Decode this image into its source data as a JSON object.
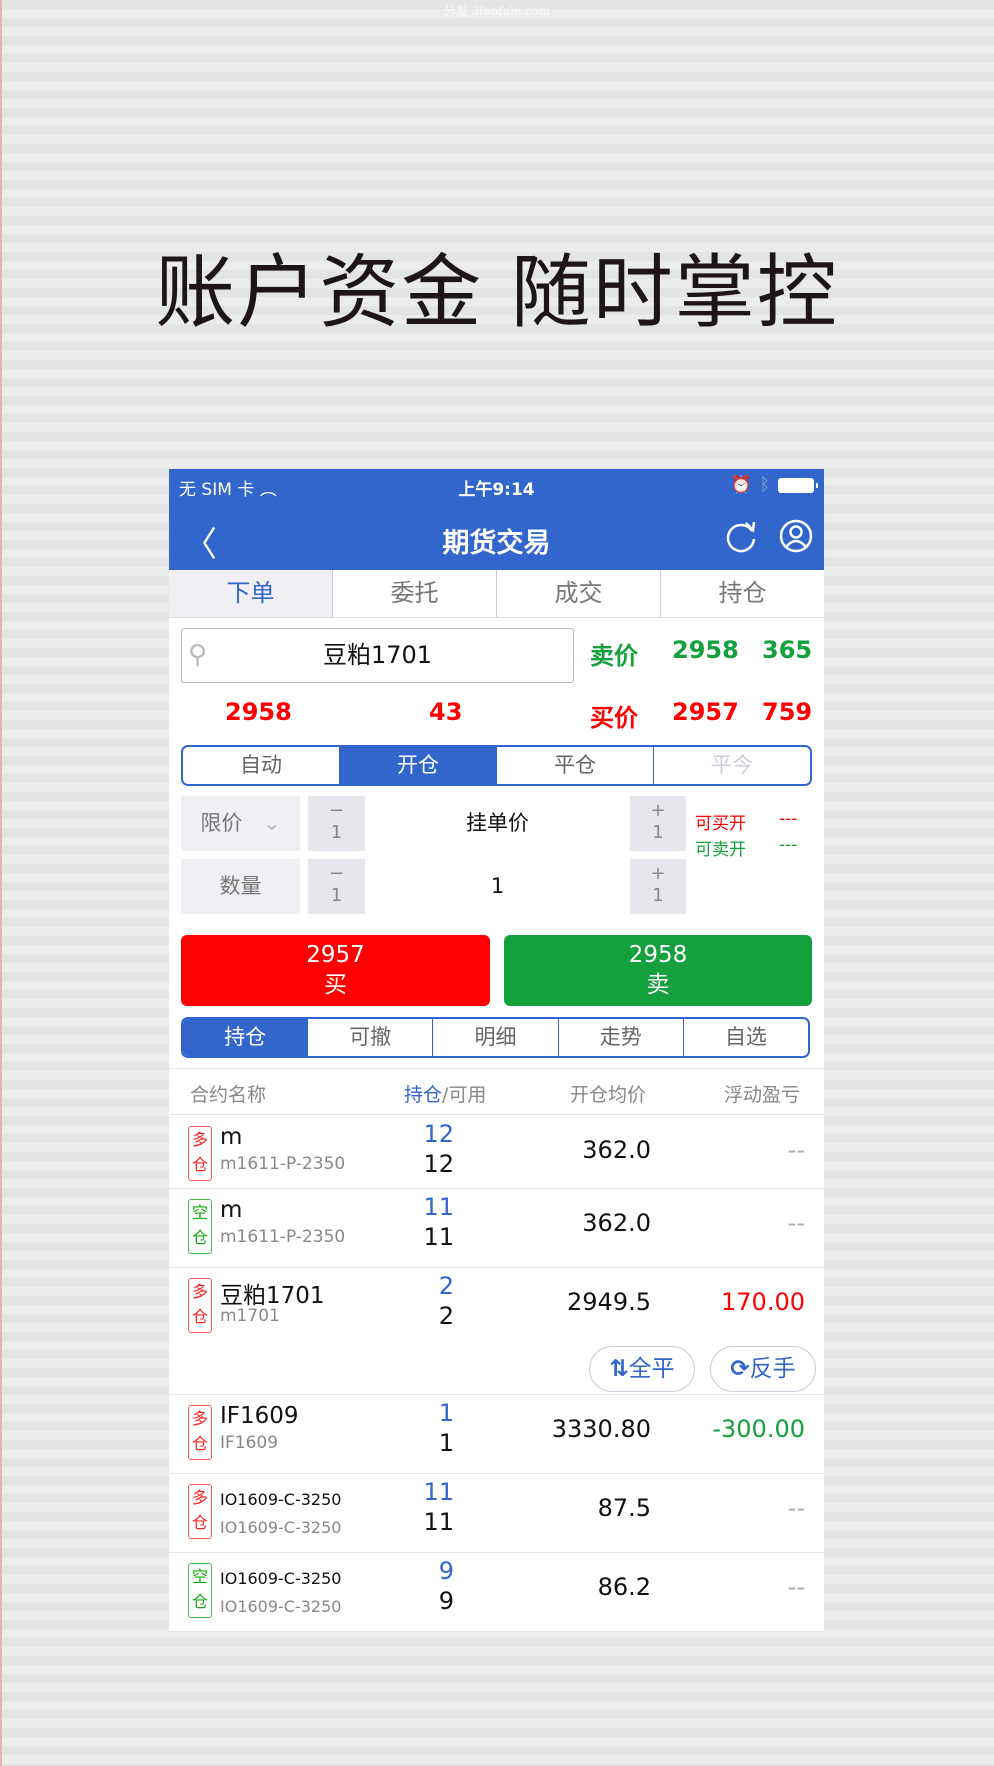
{
  "watermark": "分发 3fenfale.com",
  "headline": "账户资金 随时掌控",
  "status_bar": {
    "carrier": "无 SIM 卡",
    "time": "上午9:14"
  },
  "nav": {
    "title": "期货交易"
  },
  "tabs": [
    {
      "label": "下单",
      "active": true
    },
    {
      "label": "委托"
    },
    {
      "label": "成交"
    },
    {
      "label": "持仓"
    }
  ],
  "quote": {
    "contract": "豆粕1701",
    "sell_label": "卖价",
    "sell_price": "2958",
    "sell_vol": "365",
    "last_price": "2958",
    "change": "43",
    "buy_label": "买价",
    "buy_price": "2957",
    "buy_vol": "759"
  },
  "offset_modes": [
    {
      "label": "自动"
    },
    {
      "label": "开仓",
      "active": true
    },
    {
      "label": "平仓"
    },
    {
      "label": "平今",
      "disabled": true
    }
  ],
  "order": {
    "price_type": "限价",
    "minus_sign": "−",
    "plus_sign": "+",
    "step": "1",
    "price_placeholder": "挂单价",
    "qty_label": "数量",
    "qty_value": "1",
    "can_buy_label": "可买开",
    "can_buy_value": "---",
    "can_sell_label": "可卖开",
    "can_sell_value": "---"
  },
  "buy_button": {
    "price": "2957",
    "label": "买"
  },
  "sell_button": {
    "price": "2958",
    "label": "卖"
  },
  "subtabs": [
    {
      "label": "持仓",
      "active": true
    },
    {
      "label": "可撤"
    },
    {
      "label": "明细"
    },
    {
      "label": "走势"
    },
    {
      "label": "自选"
    }
  ],
  "table_header": {
    "name": "合约名称",
    "pos": "持仓",
    "sep": "/可用",
    "avg": "开仓均价",
    "pnl": "浮动盈亏"
  },
  "positions": [
    {
      "dir1": "多",
      "dir2": "仓",
      "side": "long",
      "name": "m",
      "code": "m1611-P-2350",
      "pos": "12",
      "avail": "12",
      "avg": "362.0",
      "pnl": "--",
      "pnl_color": "none"
    },
    {
      "dir1": "空",
      "dir2": "仓",
      "side": "short",
      "name": "m",
      "code": "m1611-P-2350",
      "pos": "11",
      "avail": "11",
      "avg": "362.0",
      "pnl": "--",
      "pnl_color": "none"
    },
    {
      "dir1": "多",
      "dir2": "仓",
      "side": "long",
      "name": "豆粕1701",
      "code": "m1701",
      "pos": "2",
      "avail": "2",
      "avg": "2949.5",
      "pnl": "170.00",
      "pnl_color": "red"
    },
    {
      "dir1": "多",
      "dir2": "仓",
      "side": "long",
      "name": "IF1609",
      "code": "IF1609",
      "pos": "1",
      "avail": "1",
      "avg": "3330.80",
      "pnl": "-300.00",
      "pnl_color": "green"
    },
    {
      "dir1": "多",
      "dir2": "仓",
      "side": "long",
      "name": "IO1609-C-3250",
      "code": "IO1609-C-3250",
      "pos": "11",
      "avail": "11",
      "avg": "87.5",
      "pnl": "--",
      "pnl_color": "none"
    },
    {
      "dir1": "空",
      "dir2": "仓",
      "side": "short",
      "name": "IO1609-C-3250",
      "code": "IO1609-C-3250",
      "pos": "9",
      "avail": "9",
      "avg": "86.2",
      "pnl": "--",
      "pnl_color": "none"
    }
  ],
  "row_actions": {
    "close_all": "全平",
    "reverse": "反手"
  },
  "colors": {
    "brand_blue": "#3266cc",
    "up_red": "#ff0000",
    "down_green": "#14a03c"
  }
}
